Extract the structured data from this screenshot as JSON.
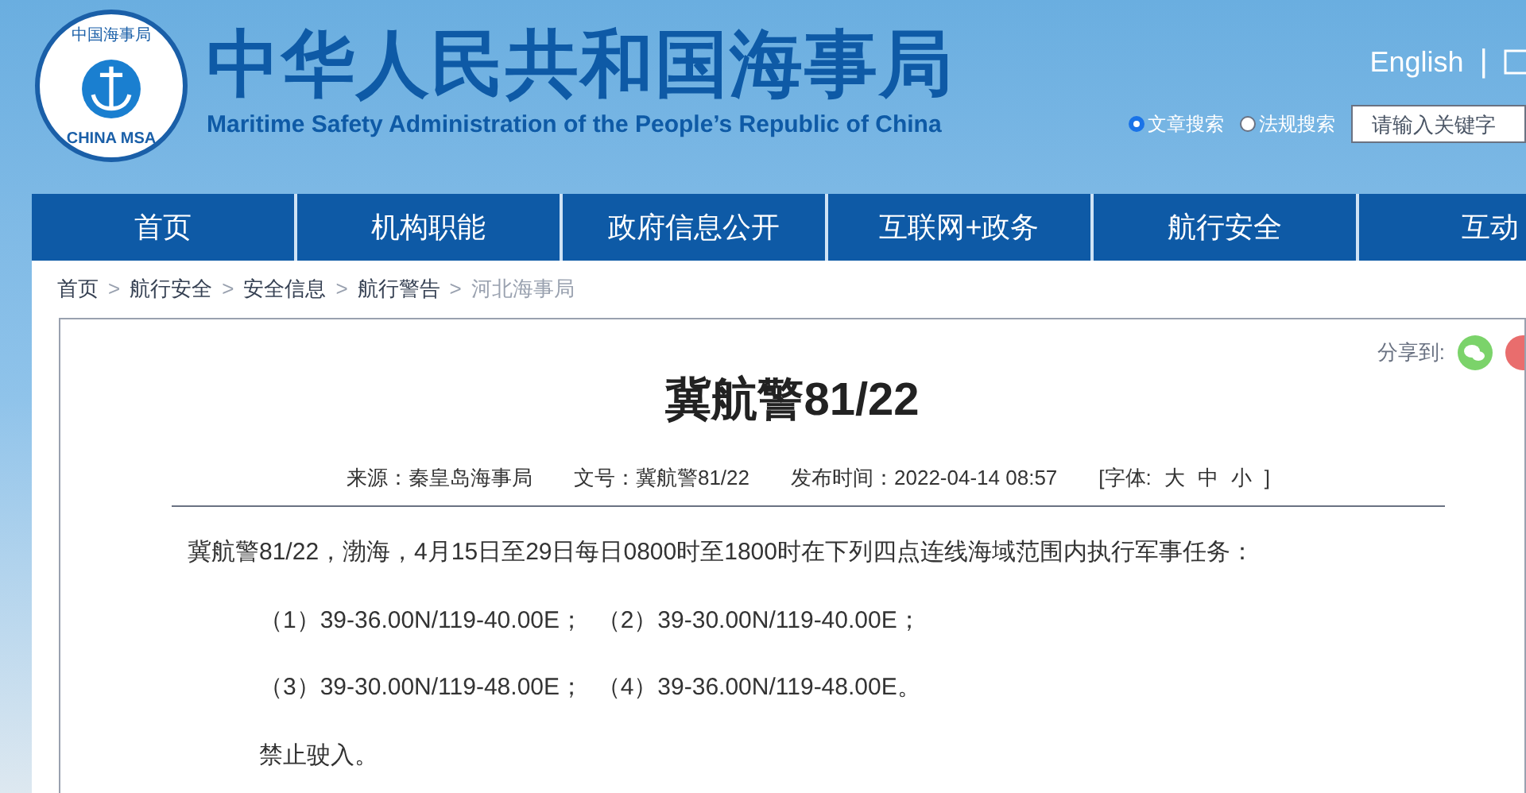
{
  "header": {
    "logo": {
      "arc_text": "中国海事局",
      "bottom_text": "CHINA MSA"
    },
    "title": "中华人民共和国海事局",
    "subtitle": "Maritime Safety Administration of the People’s Republic of China",
    "language_link": "English",
    "separator": "|",
    "search_options": [
      {
        "label": "文章搜索",
        "selected": true
      },
      {
        "label": "法规搜索",
        "selected": false
      }
    ],
    "search": {
      "placeholder": "请输入关键字"
    }
  },
  "nav": [
    {
      "label": "首页"
    },
    {
      "label": "机构职能"
    },
    {
      "label": "政府信息公开"
    },
    {
      "label": "互联网+政务"
    },
    {
      "label": "航行安全"
    },
    {
      "label": "互动"
    }
  ],
  "breadcrumb": [
    {
      "label": "首页",
      "current": false
    },
    {
      "label": "航行安全",
      "current": false
    },
    {
      "label": "安全信息",
      "current": false
    },
    {
      "label": "航行警告",
      "current": false
    },
    {
      "label": "河北海事局",
      "current": true
    }
  ],
  "breadcrumb_separator": ">",
  "article": {
    "share_label": "分享到:",
    "title": "冀航警81/22",
    "meta": [
      {
        "kind": "text",
        "text": "来源：秦皇岛海事局"
      },
      {
        "kind": "text",
        "text": "文号：冀航警81/22"
      },
      {
        "kind": "text",
        "text": "发布时间：2022-04-14 08:57"
      },
      {
        "kind": "font",
        "open": "[字体:",
        "sizes": [
          "大",
          "中",
          "小"
        ],
        "close": "]"
      }
    ],
    "paragraphs": [
      {
        "kind": "lead",
        "text": "冀航警81/22，渤海，4月15日至29日每日0800时至1800时在下列四点连线海域范围内执行军事任务："
      },
      {
        "kind": "indent",
        "text": "（1）39-36.00N/119-40.00E；  （2）39-30.00N/119-40.00E；"
      },
      {
        "kind": "indent",
        "text": "（3）39-30.00N/119-48.00E；  （4）39-36.00N/119-48.00E。"
      },
      {
        "kind": "indent",
        "text": "禁止驶入。"
      }
    ]
  }
}
